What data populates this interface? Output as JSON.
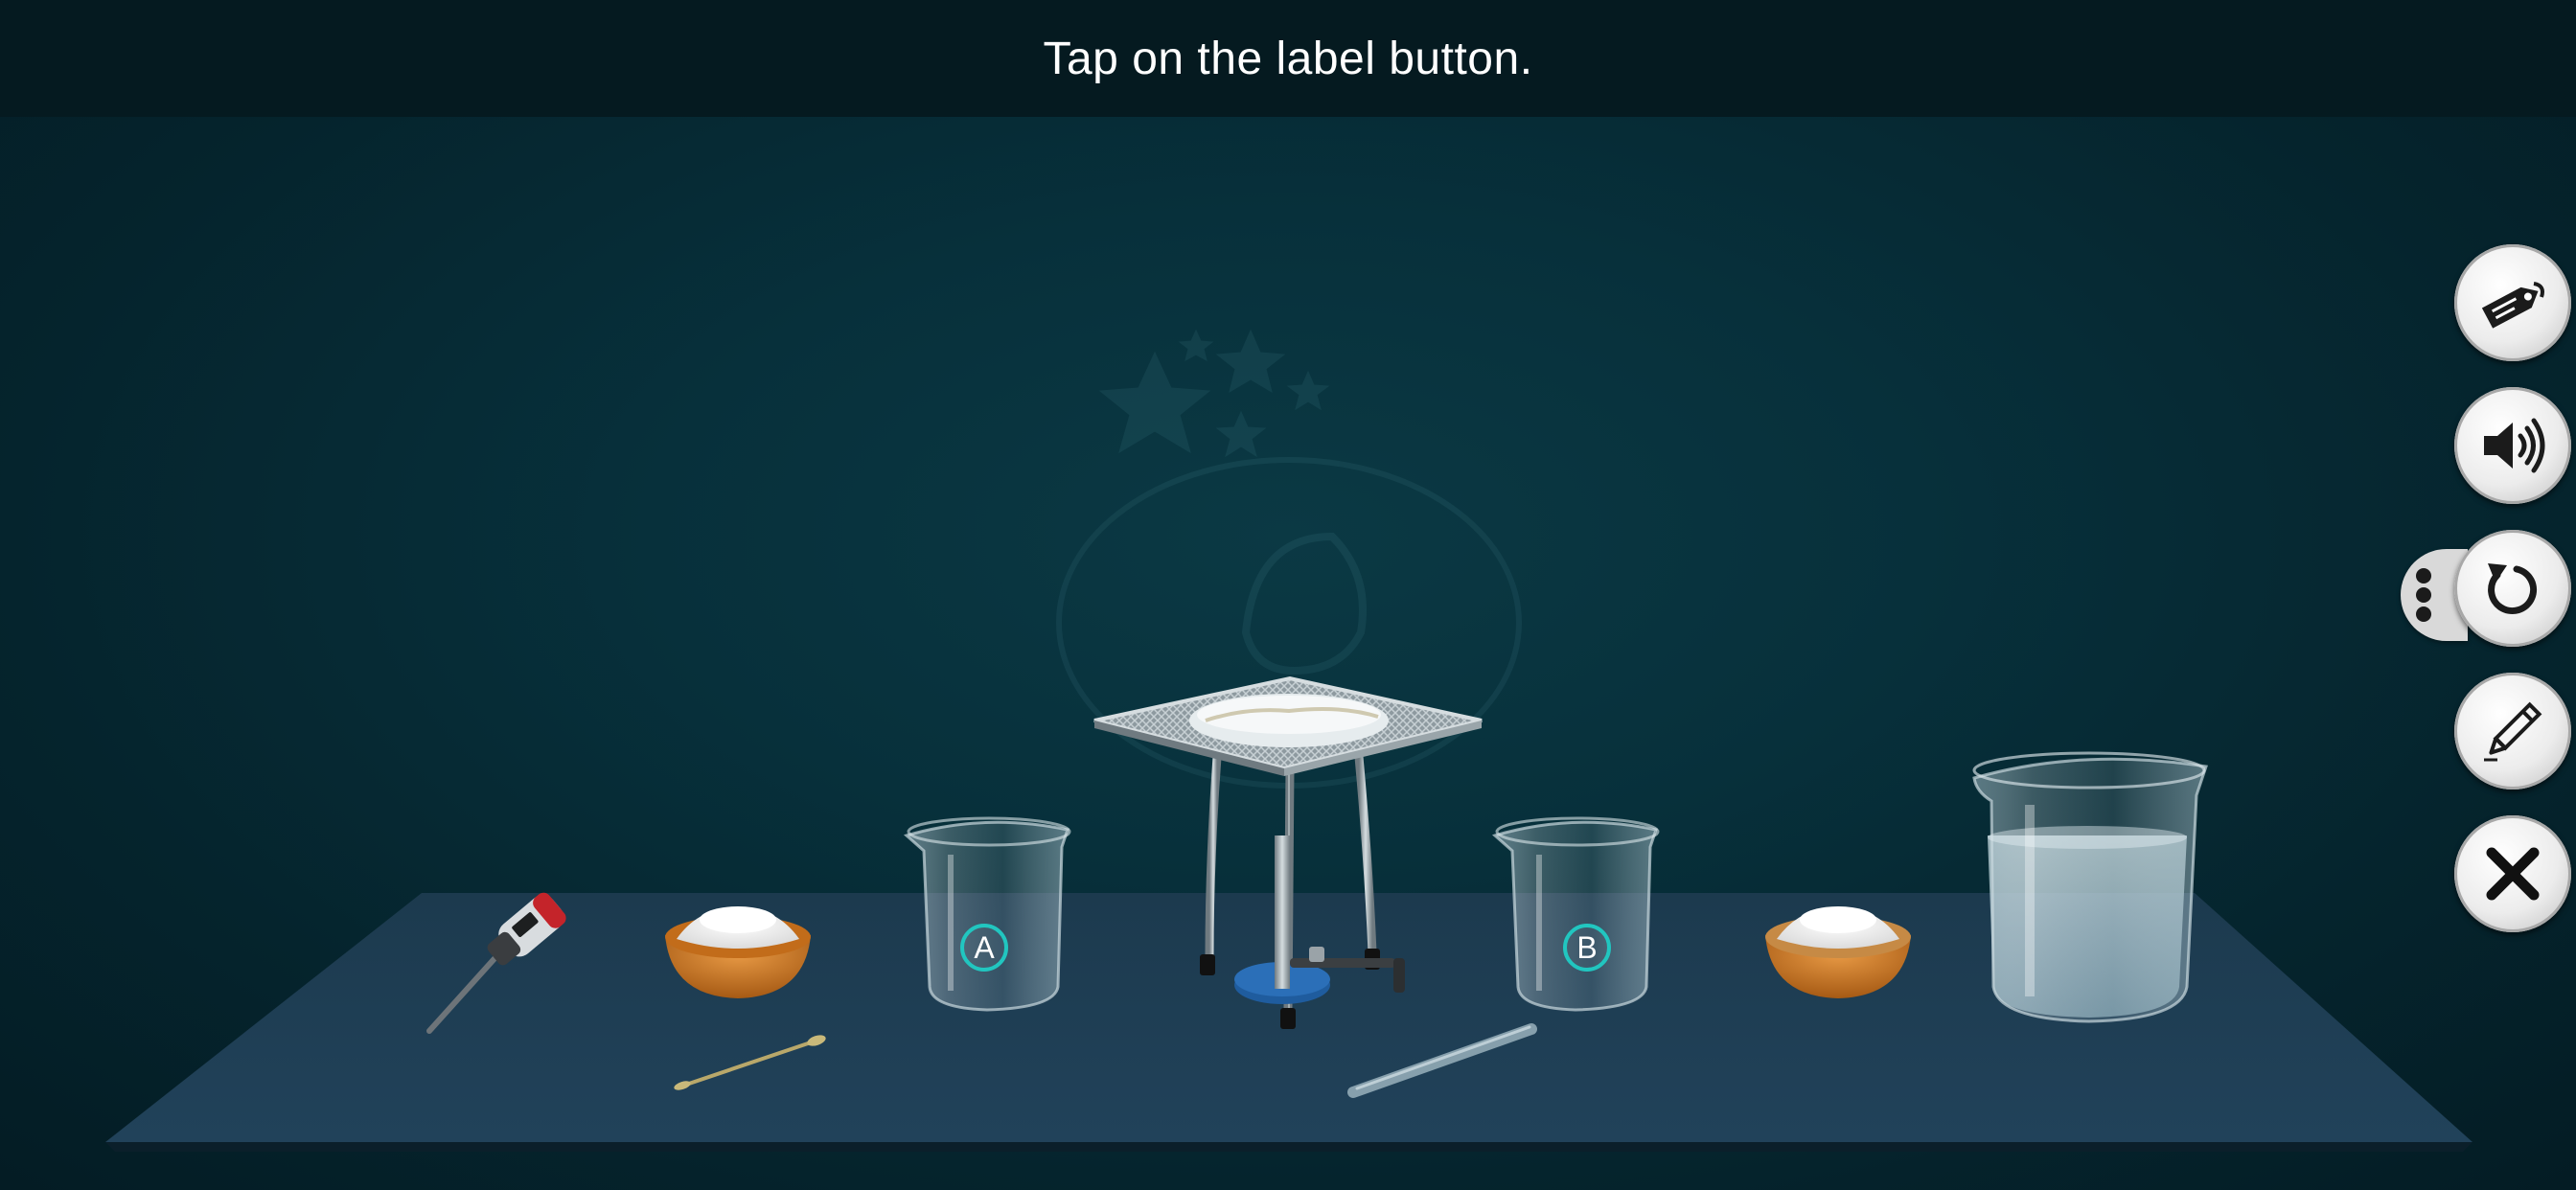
{
  "header": {
    "instruction": "Tap on the label button."
  },
  "controls": [
    {
      "name": "label-button",
      "icon": "label-tag-icon"
    },
    {
      "name": "sound-button",
      "icon": "speaker-icon"
    },
    {
      "name": "reset-button",
      "icon": "reset-arrow-icon"
    },
    {
      "name": "notes-button",
      "icon": "pencil-icon"
    },
    {
      "name": "close-button",
      "icon": "close-icon"
    }
  ],
  "menu_tab": {
    "icon": "vertical-dots-icon"
  },
  "labels": {
    "beaker_a": "A",
    "beaker_b": "B"
  },
  "apparatus": [
    "digital-thermometer",
    "bowl-of-white-powder-left",
    "spatula",
    "beaker-a",
    "tripod-stand-with-wire-gauze",
    "bunsen-burner",
    "glass-rod",
    "beaker-b",
    "bowl-of-white-powder-right",
    "large-beaker-with-water"
  ],
  "colors": {
    "background": "#07303b",
    "topbar": "#051a20",
    "table": "#1e3d52",
    "label_ring": "#21c6c0",
    "bowl": "#c8741f",
    "burner": "#2b6fb8"
  }
}
